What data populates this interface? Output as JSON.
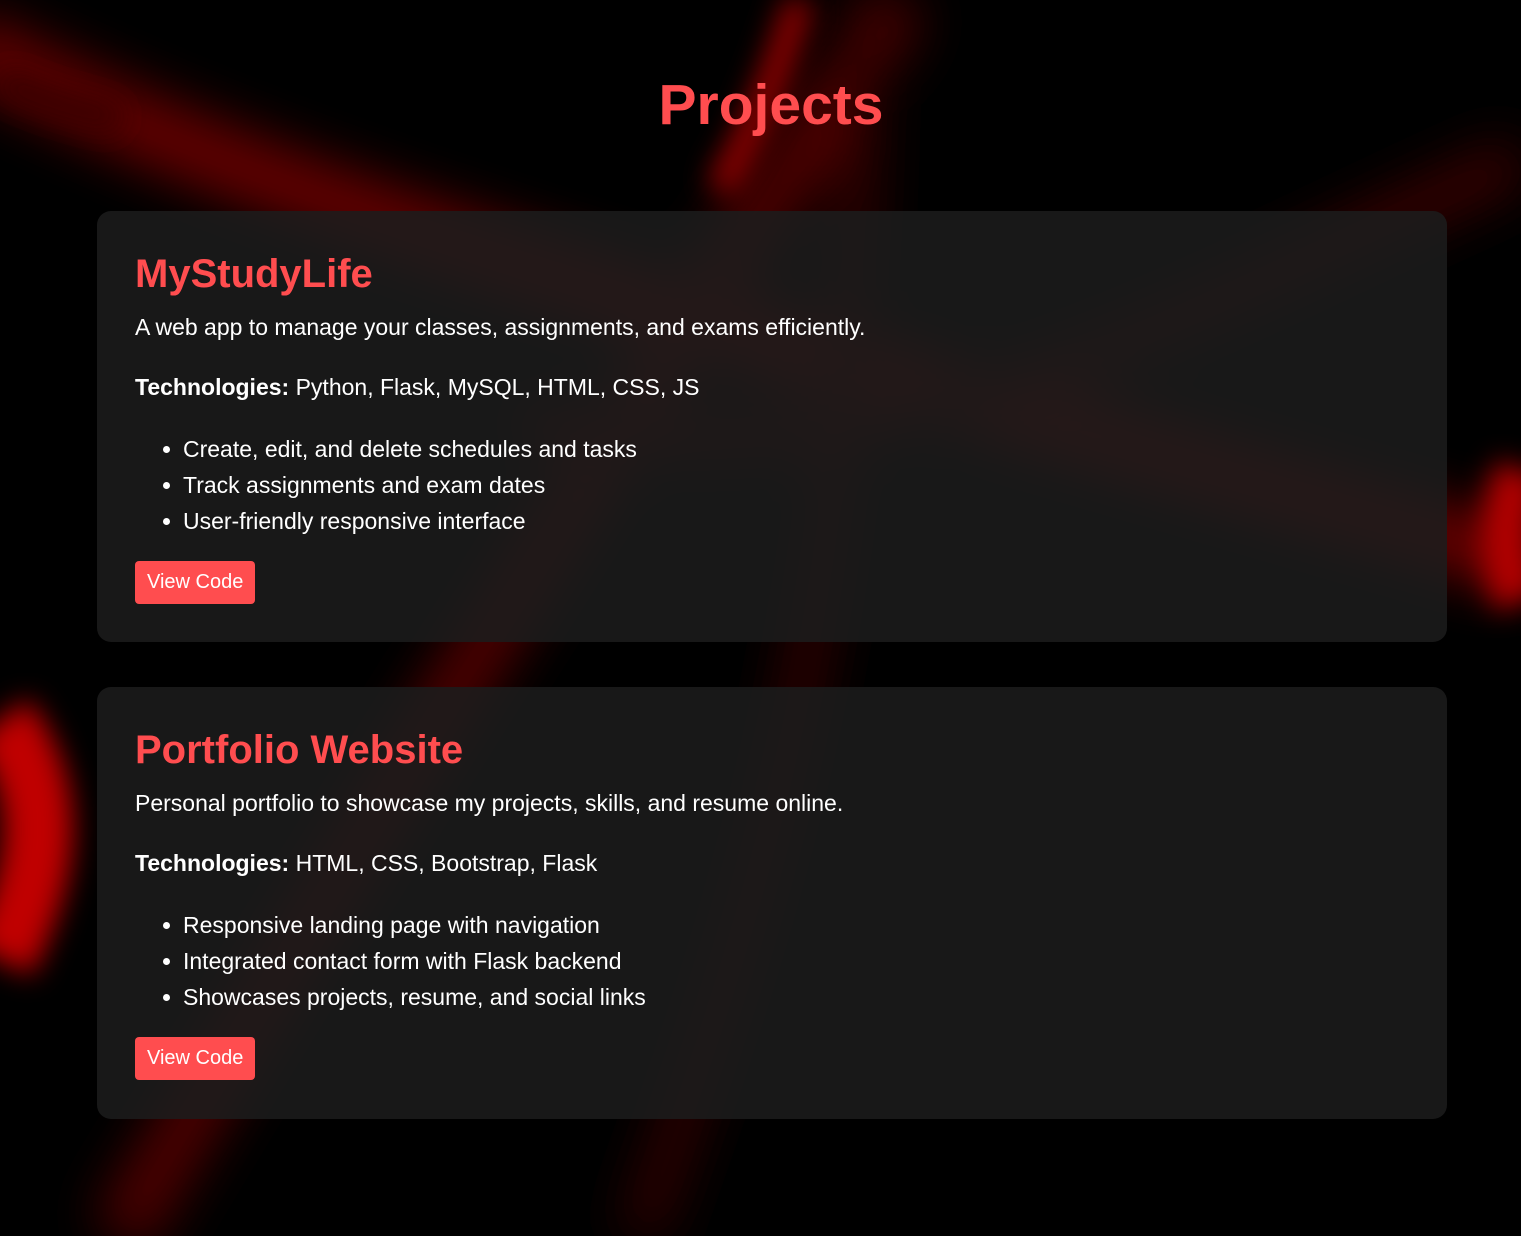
{
  "page": {
    "title": "Projects"
  },
  "colors": {
    "accent": "#ff4d4f",
    "card_bg": "#1c1c1c",
    "background": "#000000",
    "text": "#ffffff"
  },
  "projects": [
    {
      "title": "MyStudyLife",
      "description": "A web app to manage your classes, assignments, and exams efficiently.",
      "tech_label": "Technologies:",
      "tech_list": " Python, Flask, MySQL, HTML, CSS, JS",
      "features": [
        "Create, edit, and delete schedules and tasks",
        "Track assignments and exam dates",
        "User-friendly responsive interface"
      ],
      "button_label": "View Code"
    },
    {
      "title": "Portfolio Website",
      "description": "Personal portfolio to showcase my projects, skills, and resume online.",
      "tech_label": "Technologies:",
      "tech_list": " HTML, CSS, Bootstrap, Flask",
      "features": [
        "Responsive landing page with navigation",
        "Integrated contact form with Flask backend",
        "Showcases projects, resume, and social links"
      ],
      "button_label": "View Code"
    }
  ]
}
